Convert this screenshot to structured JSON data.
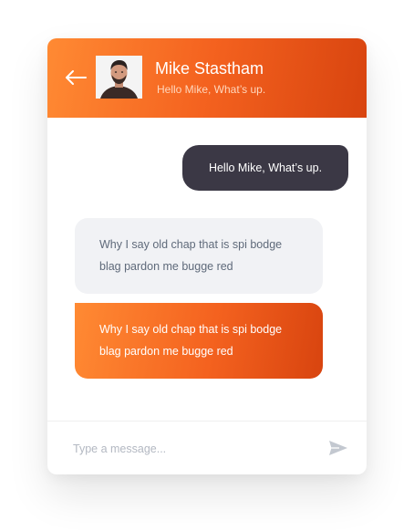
{
  "header": {
    "contact_name": "Mike Stastham",
    "contact_status": "Hello Mike, What’s up.",
    "back_icon": "arrow-left-icon",
    "avatar": "contact-avatar"
  },
  "messages": [
    {
      "direction": "outgoing",
      "text": "Hello Mike, What’s up."
    },
    {
      "direction": "incoming",
      "text": "Why I say old chap that is spi bodge blag pardon me bugge red"
    },
    {
      "direction": "incoming-highlight",
      "text": "Why I say old chap that is spi bodge blag pardon me bugge red"
    }
  ],
  "composer": {
    "placeholder": "Type a message...",
    "send_icon": "send-icon"
  },
  "colors": {
    "accent_start": "#ff8a33",
    "accent_end": "#d8440f",
    "outgoing_bubble": "#3b3845",
    "incoming_bubble": "#f1f2f5"
  }
}
